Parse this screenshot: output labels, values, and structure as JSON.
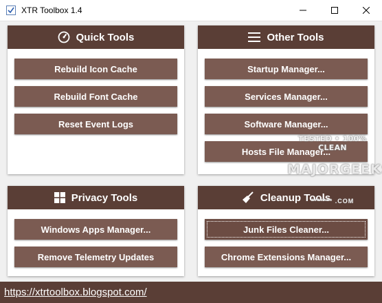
{
  "window": {
    "title": "XTR Toolbox 1.4"
  },
  "colors": {
    "header_bg": "#5a3e36",
    "button_bg": "#7b5b52",
    "client_bg": "#f0f0f0"
  },
  "panels": {
    "quick_tools": {
      "title": "Quick Tools",
      "icon": "speedometer-icon",
      "buttons": [
        "Rebuild Icon Cache",
        "Rebuild Font Cache",
        "Reset Event Logs"
      ]
    },
    "other_tools": {
      "title": "Other Tools",
      "icon": "hamburger-menu-icon",
      "buttons": [
        "Startup Manager...",
        "Services Manager...",
        "Software Manager...",
        "Hosts File Manager..."
      ]
    },
    "privacy_tools": {
      "title": "Privacy Tools",
      "icon": "windows-logo-icon",
      "buttons": [
        "Windows Apps Manager...",
        "Remove Telemetry Updates"
      ]
    },
    "cleanup_tools": {
      "title": "Cleanup Tools",
      "icon": "broom-icon",
      "buttons": [
        "Junk Files Cleaner...",
        "Chrome Extensions Manager..."
      ]
    }
  },
  "footer": {
    "link": "https://xtrtoolbox.blogspot.com/"
  },
  "watermark": {
    "line1": "TESTED • 100% CLEAN",
    "line2": "MAJORGEEKS",
    "line3": "******* .COM"
  }
}
